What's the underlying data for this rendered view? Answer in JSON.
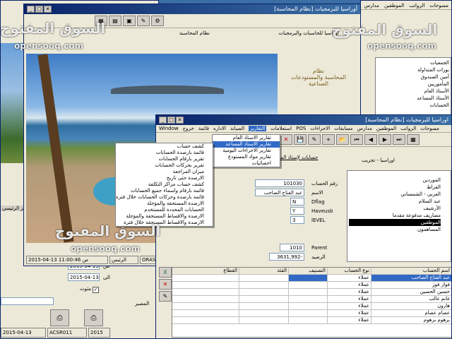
{
  "bg_window_left": {
    "labels": [
      "المركز الرئيسي",
      "من",
      "الى",
      "مثوث",
      "المصير"
    ],
    "from_date": "2015-04-13",
    "to_date": "2015-04-13",
    "status_bar": [
      "2015-04-13",
      "ACSR011",
      "2015"
    ]
  },
  "bg_window_right": {
    "menu": [
      "مسوحات",
      "الرواتب",
      "الموظفين",
      "مدارس"
    ],
    "items": [
      "الجمعيات",
      "بورات المتداولة",
      "أمين الصندوق",
      "المأموريين",
      "الأستاذ العام",
      "الأستاذ المساعد",
      "الحسابات",
      "الأستاذ المساعد"
    ]
  },
  "main_window": {
    "title": "أوراسيا للبرمجيات  [نظام المحاسبة]",
    "subtitle_right": "اوراسيا للحاسبات والبرمجيات",
    "subtitle_left": "نظام المحاسبة",
    "logo_text": [
      "نظام",
      "المحاسبة والمستودعات",
      "الصناعية"
    ],
    "status_bar": [
      "ORASIA",
      "الرئيس",
      "2015-04-13  11:00:46 ص"
    ]
  },
  "accounting_window": {
    "title": "اوراسيا للبرمجيات  [نظام المحاسبة]",
    "menu": [
      "Window",
      "خروج",
      "قائمة",
      "الاداره",
      "الصيانة",
      "التقارير",
      "استعلامات",
      "POS",
      "الاجراءات",
      "مسابقات",
      "مدارس",
      "الموظفين",
      "الرواتب",
      "مسوحات"
    ],
    "tab_title": "حسابات لإستاذ المساعد",
    "breadcrumb": "اوراسيا - تجريب",
    "form": {
      "account_no_label": "رقم الحساب",
      "account_no": "101030",
      "name_label": "الاسم",
      "name": "عبد الفتاح الصاحب",
      "field3_value": "N",
      "field3_label": "Dflag",
      "field4_value": "Y",
      "field4_label": "Haveusb",
      "field5_value": "3",
      "field5_label": "lEVEL",
      "parent_value": "1010",
      "parent_label": "Parent",
      "balance_label": "الرصيد",
      "balance": "3631,992-"
    },
    "tree_items": [
      "الموردين",
      "الفراط",
      "العربي - الشمساني",
      "عبد السلام",
      "الأرشيف",
      "مصاريف مدفوعة مقدما",
      "الموظفين",
      "المساهمون"
    ],
    "grid": {
      "headers": [
        "اسم الحساب",
        "نوع الحساب",
        "التصنيف",
        "الفئة",
        "القطاع"
      ],
      "rows": [
        [
          "عبد الفتاح الصاحب",
          "عملاء",
          "",
          "",
          ""
        ],
        [
          "فواز فوز",
          "عملاء",
          "",
          "",
          ""
        ],
        [
          "حسين الحسين",
          "عملاء",
          "",
          "",
          ""
        ],
        [
          "غانم غالب",
          "عملاء",
          "",
          "",
          ""
        ],
        [
          "هارون",
          "عملاء",
          "",
          "",
          ""
        ],
        [
          "عصام عصام",
          "عملاء",
          "",
          "",
          ""
        ],
        [
          "برهوم برهوم",
          "عملاء",
          "",
          "",
          ""
        ]
      ]
    }
  },
  "reports_menu": {
    "items": [
      "تقارير الاستاذ العام",
      "تقارير الاستاذ المساعد",
      "تقارير الاجراءات اليومية",
      "تقارير مواد المستودع",
      "احصائيات"
    ]
  },
  "submenu": {
    "items": [
      "كشف حساب",
      "قائمة بارصدة الحسابات",
      "تقرير بارقام الحسابات",
      "تقرير بحركات الحسابات",
      "ميزان المراجعة",
      "الارصدة حتى تاريخ",
      "كشف حساب مراكز التكلفة",
      "قائمة بارقام واسماء جميع الحسابات",
      "قائمة بارصدة وحركات الحسابات خلال فترة",
      "الارصدة المستحقة والمؤجلة",
      "الحسابات المحددة للمستخدم",
      "الارصدة والاقساط المستحقة والمؤجلة",
      "الارصدة والاقساط المستحقة خلال فترة"
    ]
  },
  "watermark": {
    "text_ar": "السوق المفتوح",
    "text_en": "opensooq.com"
  },
  "colors": {
    "title_bar": "#0a246a",
    "menu_highlight": "#316ac5",
    "window_bg": "#ece9d8"
  }
}
